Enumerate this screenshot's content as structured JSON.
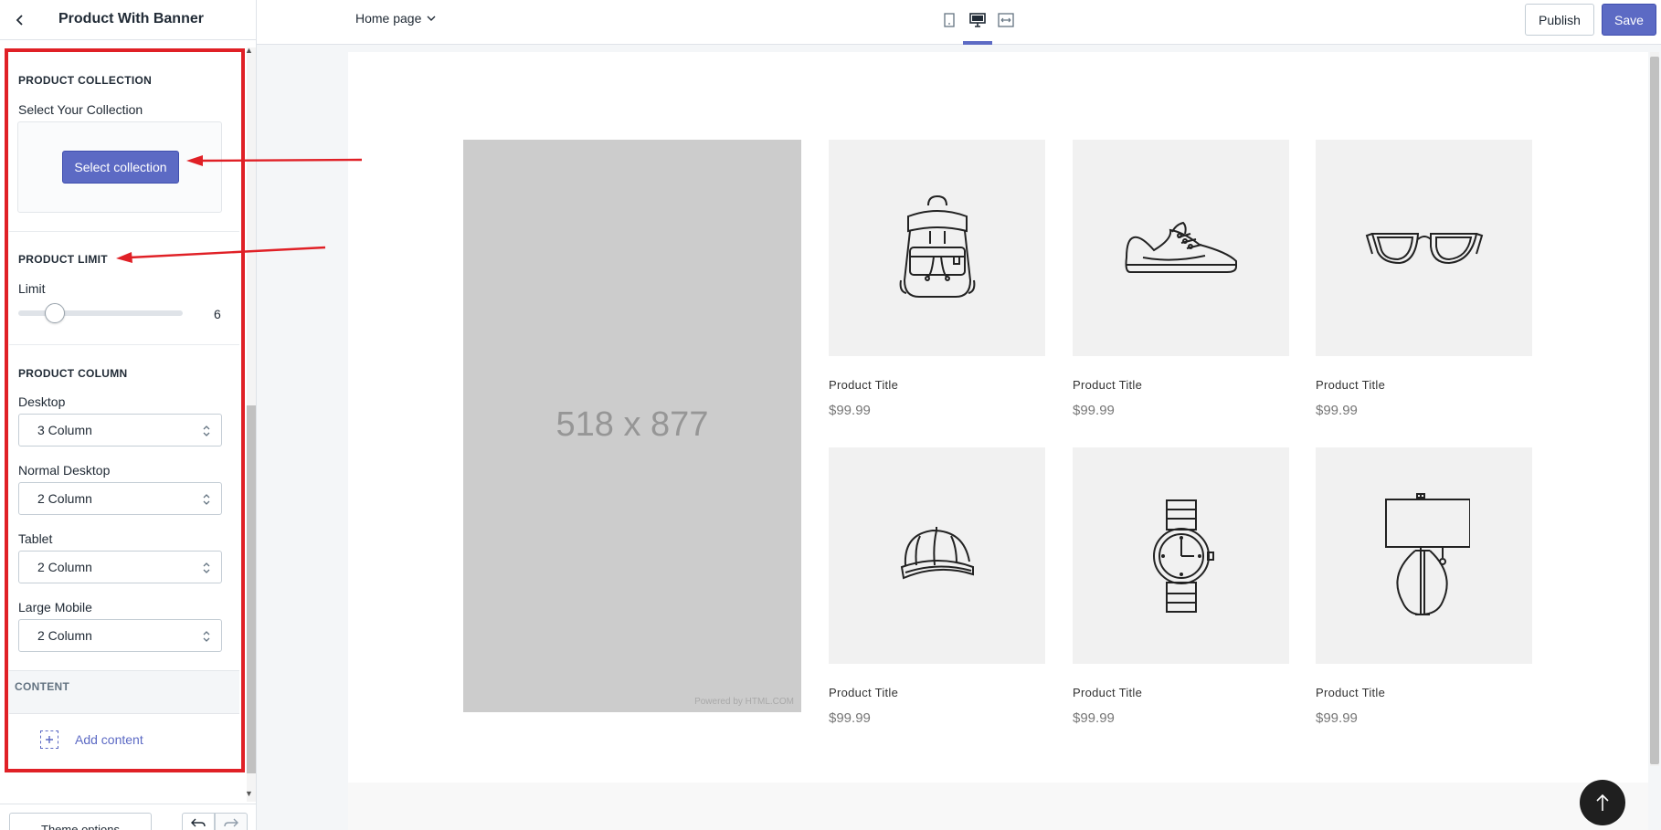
{
  "sidebar": {
    "title": "Product With Banner",
    "sections": {
      "collection": {
        "title": "PRODUCT COLLECTION",
        "label": "Select Your Collection",
        "button": "Select collection"
      },
      "limit": {
        "title": "PRODUCT LIMIT",
        "label": "Limit",
        "value": "6",
        "slider_fraction": 0.22
      },
      "column": {
        "title": "PRODUCT COLUMN",
        "fields": [
          {
            "label": "Desktop",
            "value": "3 Column"
          },
          {
            "label": "Normal Desktop",
            "value": "2 Column"
          },
          {
            "label": "Tablet",
            "value": "2 Column"
          },
          {
            "label": "Large Mobile",
            "value": "2 Column"
          }
        ]
      },
      "content": {
        "title": "CONTENT",
        "add_label": "Add content"
      }
    },
    "footer": {
      "theme_options": "Theme options"
    }
  },
  "topbar": {
    "page": "Home page",
    "publish": "Publish",
    "save": "Save",
    "devices": [
      "mobile-icon",
      "desktop-icon",
      "fullwidth-icon"
    ]
  },
  "preview": {
    "banner": {
      "placeholder": "518 x 877",
      "powered": "Powered by HTML.COM"
    },
    "products": [
      {
        "title": "Product Title",
        "price": "$99.99",
        "icon": "backpack-icon"
      },
      {
        "title": "Product Title",
        "price": "$99.99",
        "icon": "sneaker-icon"
      },
      {
        "title": "Product Title",
        "price": "$99.99",
        "icon": "glasses-icon"
      },
      {
        "title": "Product Title",
        "price": "$99.99",
        "icon": "cap-icon"
      },
      {
        "title": "Product Title",
        "price": "$99.99",
        "icon": "watch-icon"
      },
      {
        "title": "Product Title",
        "price": "$99.99",
        "icon": "lamp-icon"
      }
    ]
  },
  "colors": {
    "accent": "#5c6ac4",
    "annotation": "#e02026"
  }
}
